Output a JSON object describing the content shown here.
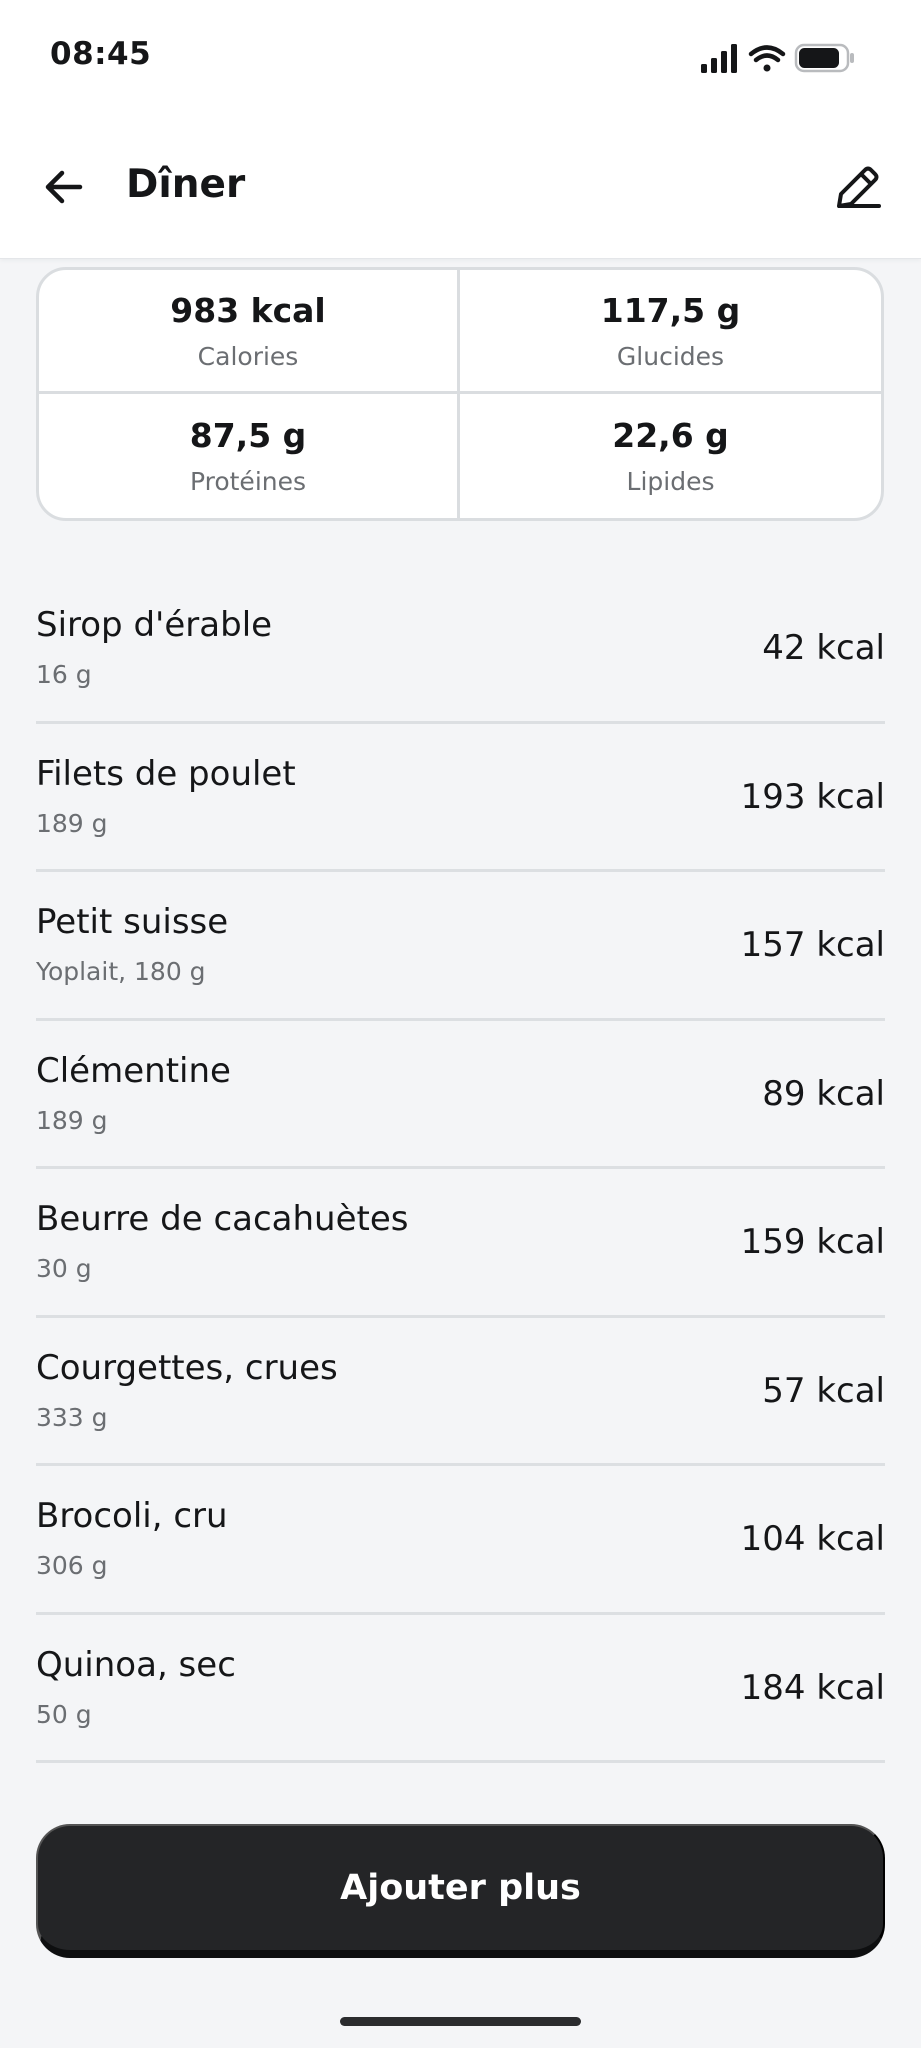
{
  "status_bar": {
    "time": "08:45",
    "icons": [
      "signal-icon",
      "wifi-icon",
      "battery-icon"
    ]
  },
  "header": {
    "title": "Dîner",
    "back_icon": "arrow-left-icon",
    "edit_icon": "pencil-icon"
  },
  "summary": {
    "calories": {
      "value": "983 kcal",
      "label": "Calories"
    },
    "carbs": {
      "value": "117,5 g",
      "label": "Glucides"
    },
    "protein": {
      "value": "87,5 g",
      "label": "Protéines"
    },
    "fat": {
      "value": "22,6 g",
      "label": "Lipides"
    }
  },
  "foods": [
    {
      "name": "Sirop d'érable",
      "detail": "16 g",
      "kcal": "42 kcal"
    },
    {
      "name": "Filets de poulet",
      "detail": "189 g",
      "kcal": "193 kcal"
    },
    {
      "name": "Petit suisse",
      "detail": "Yoplait, 180 g",
      "kcal": "157 kcal"
    },
    {
      "name": "Clémentine",
      "detail": "189 g",
      "kcal": "89 kcal"
    },
    {
      "name": "Beurre de cacahuètes",
      "detail": "30 g",
      "kcal": "159 kcal"
    },
    {
      "name": "Courgettes, crues",
      "detail": "333 g",
      "kcal": "57 kcal"
    },
    {
      "name": "Brocoli, cru",
      "detail": "306 g",
      "kcal": "104 kcal"
    },
    {
      "name": "Quinoa, sec",
      "detail": "50 g",
      "kcal": "184 kcal"
    }
  ],
  "actions": {
    "add_more_label": "Ajouter plus"
  },
  "colors": {
    "background": "#f4f5f7",
    "button": "#242527",
    "muted_text": "#6b6e72",
    "divider": "#dcdfe2"
  }
}
